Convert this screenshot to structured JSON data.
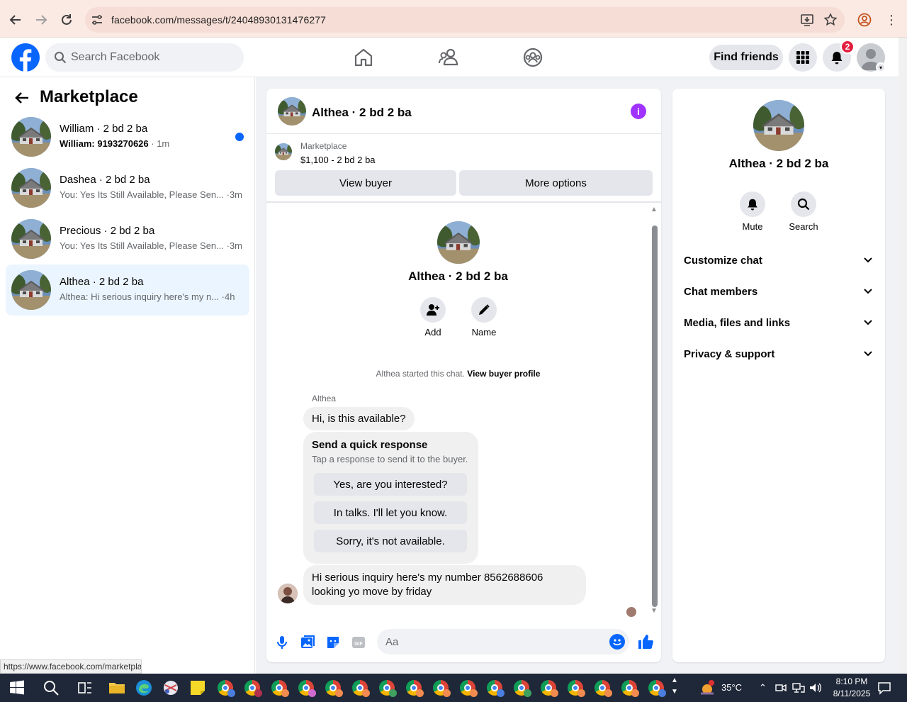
{
  "browser": {
    "url": "facebook.com/messages/t/24048930131476277",
    "status_url": "https://www.facebook.com/marketplace"
  },
  "fbnav": {
    "search_placeholder": "Search Facebook",
    "find_friends_label": "Find friends",
    "notifications_count": "2",
    "brand_color": "#0866ff"
  },
  "sidebar": {
    "title": "Marketplace",
    "conversations": [
      {
        "name": "William · 2 bd 2 ba",
        "sender": "William: 9193270626",
        "snippet": "",
        "time": "· 1m",
        "unread": true
      },
      {
        "name": "Dashea · 2 bd 2 ba",
        "sender": "",
        "snippet": "You: Yes Its Still Available, Please Sen...",
        "time": "·3m",
        "unread": false
      },
      {
        "name": "Precious · 2 bd 2 ba",
        "sender": "",
        "snippet": "You: Yes Its Still Available, Please Sen...",
        "time": "·3m",
        "unread": false
      },
      {
        "name": "Althea · 2 bd 2 ba",
        "sender": "",
        "snippet": "Althea: Hi serious inquiry here's my n...",
        "time": "·4h",
        "unread": false
      }
    ]
  },
  "chat": {
    "title": "Althea · 2 bd 2 ba",
    "marketplace_label": "Marketplace",
    "listing_price": "$1,100 - 2 bd 2 ba",
    "view_buyer_label": "View buyer",
    "more_options_label": "More options",
    "center_title": "Althea · 2 bd 2 ba",
    "add_label": "Add",
    "name_label": "Name",
    "started_text": "Althea started this chat.",
    "view_buyer_profile_label": "View buyer profile",
    "sender_name": "Althea",
    "message_1": "Hi, is this available?",
    "quick_response_title": "Send a quick response",
    "quick_response_subtitle": "Tap a response to send it to the buyer.",
    "quick_responses": [
      "Yes, are you interested?",
      "In talks. I'll let you know.",
      "Sorry, it's not available."
    ],
    "message_2_line1": "Hi serious inquiry here's my number 8562688606",
    "message_2_line2": "looking yo move by friday",
    "composer_placeholder": "Aa"
  },
  "info_panel": {
    "title": "Althea · 2 bd 2 ba",
    "mute_label": "Mute",
    "search_label": "Search",
    "sections": [
      "Customize chat",
      "Chat members",
      "Media, files and links",
      "Privacy & support"
    ]
  },
  "taskbar": {
    "temperature": "35°C",
    "time": "8:10 PM",
    "date": "8/11/2025"
  }
}
